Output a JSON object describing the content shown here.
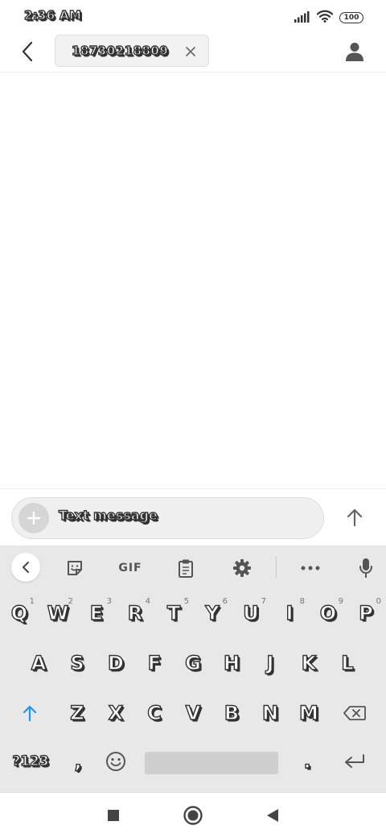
{
  "status_bar": {
    "time": "2:36 AM",
    "battery_level": "100"
  },
  "header": {
    "recipient": "18730218809"
  },
  "compose": {
    "placeholder": "Text message"
  },
  "keyboard": {
    "toolbar": {
      "gif_label": "GIF"
    },
    "row1": [
      {
        "char": "Q",
        "hint": "1"
      },
      {
        "char": "W",
        "hint": "2"
      },
      {
        "char": "E",
        "hint": "3"
      },
      {
        "char": "R",
        "hint": "4"
      },
      {
        "char": "T",
        "hint": "5"
      },
      {
        "char": "Y",
        "hint": "6"
      },
      {
        "char": "U",
        "hint": "7"
      },
      {
        "char": "I",
        "hint": "8"
      },
      {
        "char": "O",
        "hint": "9"
      },
      {
        "char": "P",
        "hint": "0"
      }
    ],
    "row2": [
      "A",
      "S",
      "D",
      "F",
      "G",
      "H",
      "J",
      "K",
      "L"
    ],
    "row3": [
      "Z",
      "X",
      "C",
      "V",
      "B",
      "N",
      "M"
    ],
    "symbols_label": "?123",
    "comma": ",",
    "period": "."
  },
  "colors": {
    "accent": "#2196f3",
    "keyboard_bg": "#e8e8e8",
    "text_outline": "#333333"
  }
}
